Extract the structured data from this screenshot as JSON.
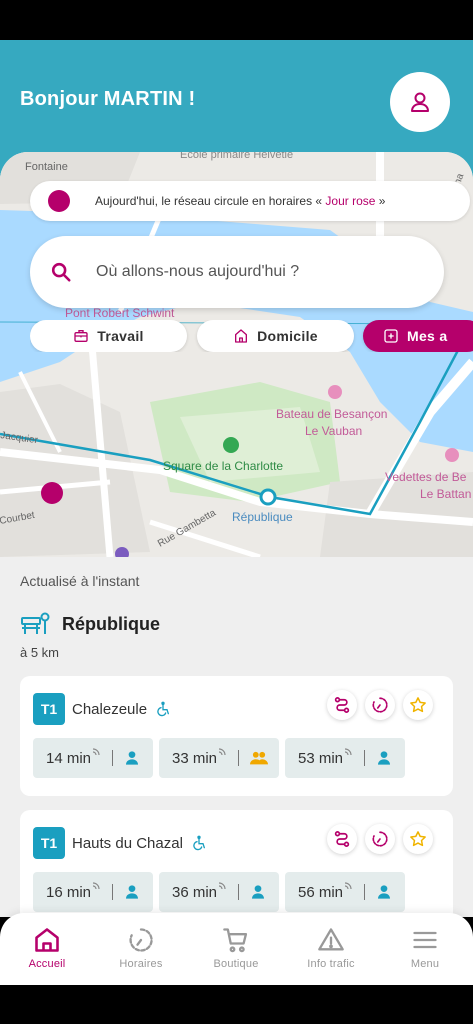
{
  "header": {
    "greeting": "Bonjour MARTIN !",
    "profile_icon": "person-icon"
  },
  "map": {
    "labels": {
      "fontaine": "Fontaine",
      "ecole": "Ecole primaire Helvetie",
      "pont": "Pont Robert Schwint",
      "bateau": "Bateau de Besançon",
      "vauban": "Le Vauban",
      "square": "Square de la Charlotte",
      "republique": "République",
      "vedettes": "Vedettes de Be",
      "battant": "Le Battan",
      "gambetta": "Rue Gambetta",
      "jacquier": "Jacquier",
      "courbet": "Courbet",
      "rue": "Rue Cha"
    }
  },
  "alert": {
    "text_before": "Aujourd'hui, le réseau circule en horaires « ",
    "highlight": "Jour rose",
    "text_after": " »",
    "color": "#b5006b"
  },
  "search": {
    "placeholder": "Où allons-nous aujourd'hui ?"
  },
  "shortcuts": [
    {
      "label": "Travail",
      "icon": "briefcase-icon"
    },
    {
      "label": "Domicile",
      "icon": "home-icon"
    },
    {
      "label": "Mes a",
      "icon": "add-square-icon"
    }
  ],
  "nearby": {
    "updated": "Actualisé à l'instant",
    "stop_name": "République",
    "stop_icon": "bus-stop-icon",
    "distance": "à 5 km",
    "departures": [
      {
        "line": "T1",
        "destination": "Chalezeule",
        "times": [
          {
            "value": "14 min",
            "crowd": "low"
          },
          {
            "value": "33 min",
            "crowd": "medium"
          },
          {
            "value": "53 min",
            "crowd": "low"
          }
        ]
      },
      {
        "line": "T1",
        "destination": "Hauts du Chazal",
        "times": [
          {
            "value": "16 min",
            "crowd": "low"
          },
          {
            "value": "36 min",
            "crowd": "low"
          },
          {
            "value": "56 min",
            "crowd": "low"
          }
        ]
      }
    ]
  },
  "tabs": [
    {
      "label": "Accueil",
      "icon": "home-icon",
      "active": true
    },
    {
      "label": "Horaires",
      "icon": "clock-icon",
      "active": false
    },
    {
      "label": "Boutique",
      "icon": "cart-icon",
      "active": false
    },
    {
      "label": "Info trafic",
      "icon": "warning-icon",
      "active": false
    },
    {
      "label": "Menu",
      "icon": "menu-icon",
      "active": false
    }
  ],
  "colors": {
    "brand_teal": "#36a9c0",
    "brand_pink": "#b5006b",
    "line_badge": "#1a9fc0",
    "crowd_low": "#1a9fc0",
    "crowd_medium": "#f0a800",
    "favorite": "#f0b400"
  }
}
